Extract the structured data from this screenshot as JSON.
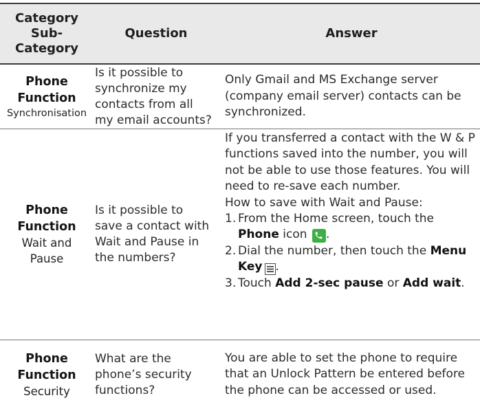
{
  "header": {
    "category": "Category",
    "subcategory": "Sub-\nCategory",
    "question": "Question",
    "answer": "Answer"
  },
  "rows": [
    {
      "category": "Phone\nFunction",
      "subcategory": "Synchronisation",
      "question": "Is it possible to synchronize my contacts from all my email accounts?",
      "answer": "Only Gmail and MS Exchange server (company email server) contacts can be synchronized."
    },
    {
      "category": "Phone\nFunction",
      "subcategory": "Wait and\nPause",
      "question": "Is it possible to save a contact with Wait and Pause in the numbers?",
      "answer_intro": "If you transferred a contact with the W & P functions saved into the number, you will not be able to use those features. You will need to re-save each number.",
      "answer_howto": "How to save with Wait and Pause:",
      "steps": [
        {
          "num": "1.",
          "pre": "From the Home screen, touch the ",
          "bold": "Phone",
          "post": " icon",
          "icon": "phone-icon",
          "end": "."
        },
        {
          "num": "2.",
          "pre": "Dial the number, then touch the ",
          "bold": "Menu Key",
          "post": " ",
          "icon": "menu-key-icon",
          "end": "."
        },
        {
          "num": "3.",
          "pre": "Touch ",
          "bold": "Add 2-sec pause",
          "mid": " or ",
          "bold2": "Add wait",
          "end": "."
        }
      ]
    },
    {
      "category": "Phone\nFunction",
      "subcategory": "Security",
      "question": "What are the phone’s security functions?",
      "answer": "You are able to set the phone to require that an Unlock Pattern be entered before the phone can be accessed or used."
    }
  ],
  "colors": {
    "header_bg": "#e9e9e9",
    "phone_icon": "#3fae49",
    "rule": "#3a3a3a"
  }
}
